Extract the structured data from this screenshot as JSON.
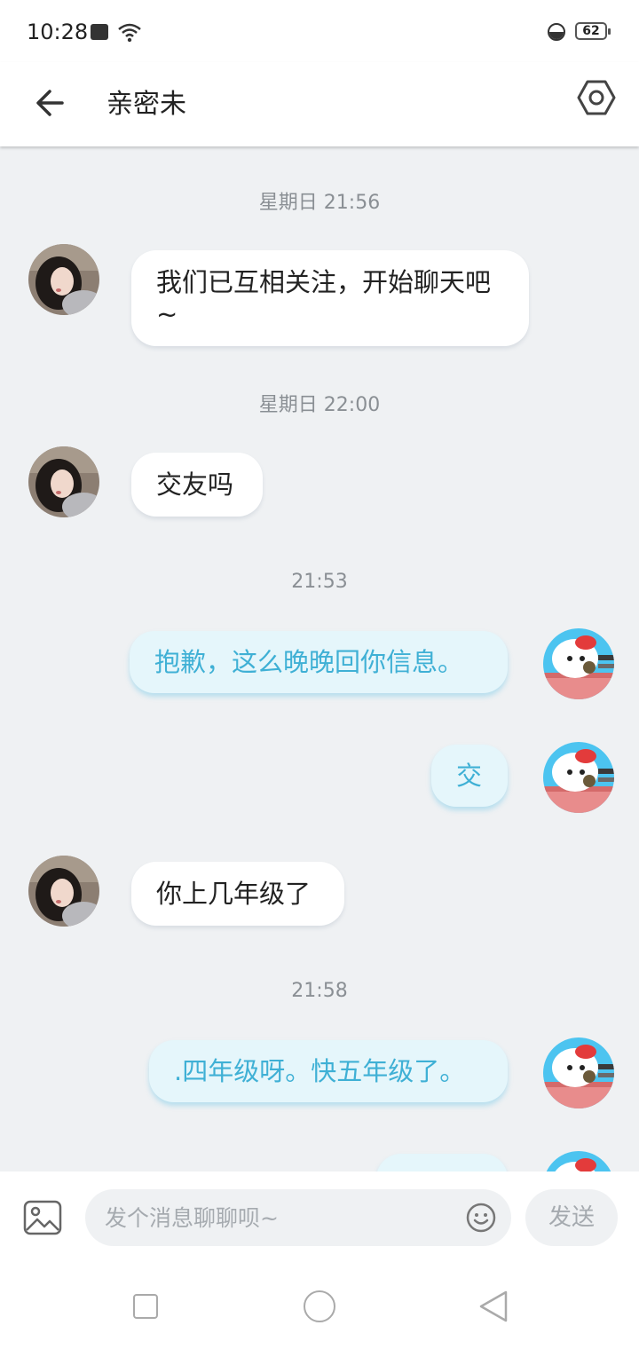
{
  "status": {
    "time": "10:28",
    "battery": "62"
  },
  "header": {
    "title": "亲密未"
  },
  "messages": [
    {
      "timestamp": "星期日 21:56",
      "text": "我们已互相关注，开始聊天吧~"
    },
    {
      "timestamp": "星期日 22:00",
      "text": "交友吗"
    },
    {
      "timestamp": "21:53",
      "text": "抱歉，这么晚晚回你信息。"
    },
    {
      "text": "交"
    },
    {
      "text": "你上几年级了"
    },
    {
      "timestamp": "21:58",
      "text": ".四年级呀。快五年级了。"
    }
  ],
  "input": {
    "placeholder": "发个消息聊聊呗~",
    "send_label": "发送"
  },
  "colors": {
    "incoming_bubble": "#ffffff",
    "outgoing_bubble": "#e5f6fb",
    "outgoing_text": "#3fb0d5",
    "chat_background": "#eff1f3"
  }
}
